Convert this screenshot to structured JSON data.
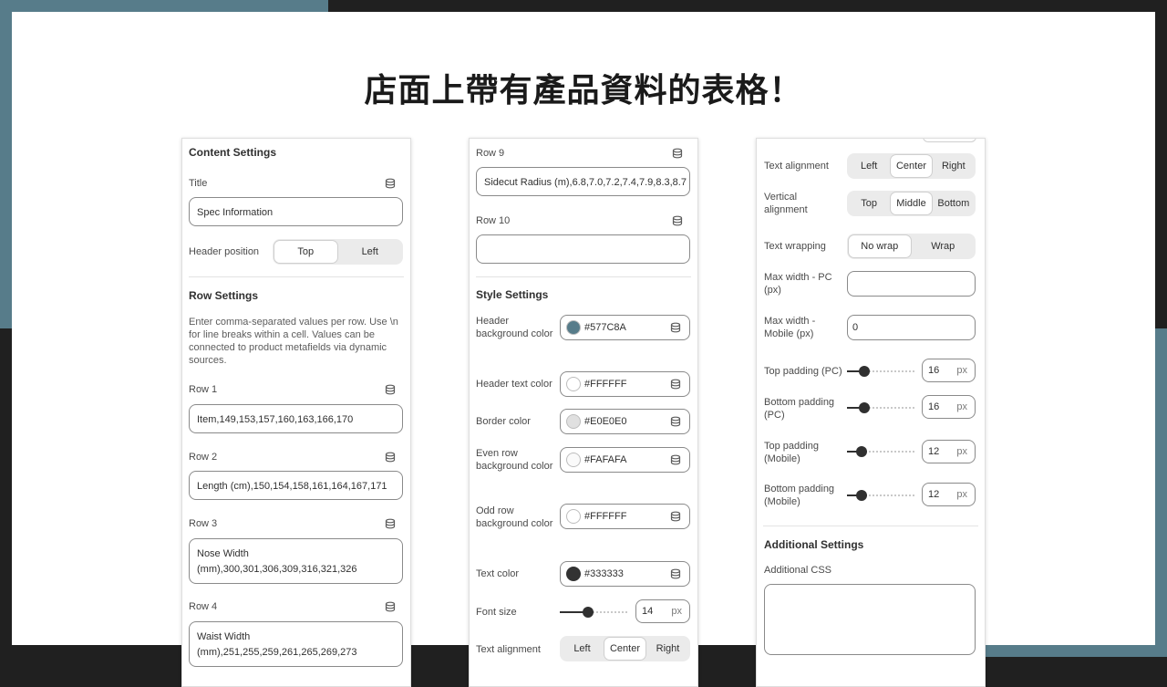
{
  "headline": "店面上帶有產品資料的表格！",
  "panel1": {
    "content_settings": "Content Settings",
    "title_label": "Title",
    "title_value": "Spec Information",
    "header_position_label": "Header position",
    "header_position_options": [
      "Top",
      "Left"
    ],
    "header_position_selected": "Top",
    "row_settings": "Row Settings",
    "row_help": "Enter comma-separated values per row. Use \\n for line breaks within a cell. Values can be connected to product metafields via dynamic sources.",
    "rows": [
      {
        "label": "Row 1",
        "value": "Item,149,153,157,160,163,166,170"
      },
      {
        "label": "Row 2",
        "value": "Length (cm),150,154,158,161,164,167,171"
      },
      {
        "label": "Row 3",
        "value": "Nose Width (mm),300,301,306,309,316,321,326"
      },
      {
        "label": "Row 4",
        "value": "Waist Width (mm),251,255,259,261,265,269,273"
      }
    ]
  },
  "panel2": {
    "rows": [
      {
        "label": "Row 9",
        "value": "Sidecut Radius (m),6.8,7.0,7.2,7.4,7.9,8.3,8.7"
      },
      {
        "label": "Row 10",
        "value": ""
      }
    ],
    "style_settings": "Style Settings",
    "colors": [
      {
        "label": "Header background color",
        "hex": "#577C8A"
      },
      {
        "label": "Header text color",
        "hex": "#FFFFFF"
      },
      {
        "label": "Border color",
        "hex": "#E0E0E0"
      },
      {
        "label": "Even row background color",
        "hex": "#FAFAFA"
      },
      {
        "label": "Odd row background color",
        "hex": "#FFFFFF"
      },
      {
        "label": "Text color",
        "hex": "#333333"
      }
    ],
    "font_size_label": "Font size",
    "font_size_value": "14",
    "font_size_unit": "px",
    "text_alignment_label": "Text alignment",
    "text_alignment_options": [
      "Left",
      "Center",
      "Right"
    ],
    "text_alignment_selected": "Center"
  },
  "panel3": {
    "text_alignment_label": "Text alignment",
    "text_alignment_options": [
      "Left",
      "Center",
      "Right"
    ],
    "text_alignment_selected": "Center",
    "vertical_alignment_label": "Vertical alignment",
    "vertical_alignment_options": [
      "Top",
      "Middle",
      "Bottom"
    ],
    "vertical_alignment_selected": "Middle",
    "text_wrapping_label": "Text wrapping",
    "text_wrapping_options": [
      "No wrap",
      "Wrap"
    ],
    "text_wrapping_selected": "No wrap",
    "max_width_pc_label": "Max width - PC (px)",
    "max_width_pc_value": "",
    "max_width_mobile_label": "Max width - Mobile (px)",
    "max_width_mobile_value": "0",
    "paddings": [
      {
        "label": "Top padding (PC)",
        "value": "16",
        "unit": "px",
        "level": 0.2
      },
      {
        "label": "Bottom padding (PC)",
        "value": "16",
        "unit": "px",
        "level": 0.2
      },
      {
        "label": "Top padding (Mobile)",
        "value": "12",
        "unit": "px",
        "level": 0.15
      },
      {
        "label": "Bottom padding (Mobile)",
        "value": "12",
        "unit": "px",
        "level": 0.15
      }
    ],
    "additional_settings": "Additional Settings",
    "additional_css_label": "Additional CSS",
    "additional_css_value": ""
  },
  "colors": {
    "accent": "#577C8A",
    "dark": "#202020"
  }
}
